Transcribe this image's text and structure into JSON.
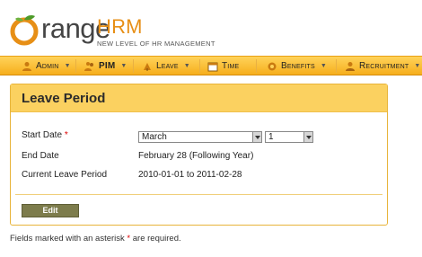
{
  "brand": {
    "name_main": "range",
    "name_suffix": "HRM",
    "tagline": "NEW LEVEL OF HR MANAGEMENT",
    "primary_color": "#e78f16",
    "leaf_color": "#4d9b2a"
  },
  "nav": {
    "items": [
      {
        "label": "Admin",
        "icon": "admin-icon"
      },
      {
        "label": "PIM",
        "icon": "pim-icon"
      },
      {
        "label": "Leave",
        "icon": "leave-icon"
      },
      {
        "label": "Time",
        "icon": "time-icon"
      },
      {
        "label": "Benefits",
        "icon": "benefits-icon"
      },
      {
        "label": "Recruitment",
        "icon": "recruitment-icon"
      }
    ],
    "bar_color": "#f8b62a"
  },
  "panel": {
    "title": "Leave Period",
    "header_color": "#fbd160",
    "start_date": {
      "label": "Start Date",
      "required_marker": "*",
      "month_value": "March",
      "day_value": "1"
    },
    "end_date": {
      "label": "End Date",
      "value": "February 28 (Following Year)"
    },
    "current_period": {
      "label": "Current Leave Period",
      "value": "2010-01-01 to 2011-02-28"
    },
    "edit_label": "Edit"
  },
  "footnote": {
    "prefix": "Fields marked with an asterisk",
    "marker": "*",
    "suffix": "are required."
  }
}
